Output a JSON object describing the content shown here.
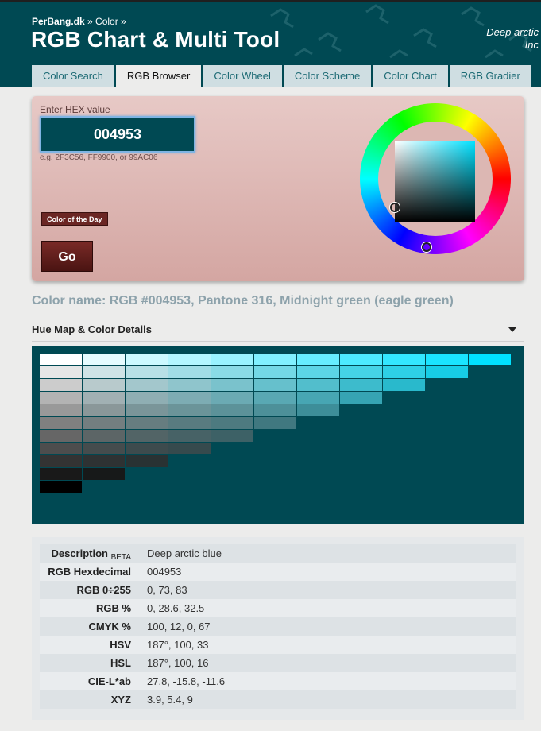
{
  "header": {
    "breadcrumb_site": "PerBang.dk",
    "breadcrumb_sep1": " » ",
    "breadcrumb_section": "Color",
    "breadcrumb_sep2": " »",
    "title": "RGB Chart & Multi Tool",
    "tagline_line1": "Deep arctic",
    "tagline_line2": "Inc"
  },
  "tabs": [
    {
      "label": "Color Search",
      "active": false
    },
    {
      "label": "RGB Browser",
      "active": true
    },
    {
      "label": "Color Wheel",
      "active": false
    },
    {
      "label": "Color Scheme",
      "active": false
    },
    {
      "label": "Color Chart",
      "active": false
    },
    {
      "label": "RGB Gradier",
      "active": false
    }
  ],
  "input_panel": {
    "hex_label": "Enter HEX value",
    "hex_value": "004953",
    "hex_hint": "e.g. 2F3C56, FF9900, or 99AC06",
    "color_of_day_label": "Color of the Day",
    "go_label": "Go"
  },
  "color_name": "Color name: RGB #004953, Pantone 316, Midnight green (eagle green)",
  "hue_map": {
    "title": "Hue Map & Color Details",
    "background": "#004953",
    "target_color": "#00e1ff"
  },
  "details": {
    "rows": [
      {
        "label": "Description",
        "badge": "BETA",
        "value": "Deep arctic blue"
      },
      {
        "label": "RGB Hexdecimal",
        "badge": "",
        "value": "004953"
      },
      {
        "label": "RGB 0÷255",
        "badge": "",
        "value": "0, 73, 83"
      },
      {
        "label": "RGB %",
        "badge": "",
        "value": "0, 28.6, 32.5"
      },
      {
        "label": "CMYK %",
        "badge": "",
        "value": "100, 12, 0, 67"
      },
      {
        "label": "HSV",
        "badge": "",
        "value": "187°, 100, 33"
      },
      {
        "label": "HSL",
        "badge": "",
        "value": "187°, 100, 16"
      },
      {
        "label": "CIE-L*ab",
        "badge": "",
        "value": "27.8, -15.8, -11.6"
      },
      {
        "label": "XYZ",
        "badge": "",
        "value": "3.9, 5.4, 9"
      }
    ]
  },
  "colors": {
    "brand_dark": "#004953",
    "tab_text": "#1d6b75",
    "panel_top": "#e7c9c6",
    "button": "#6b2624"
  }
}
